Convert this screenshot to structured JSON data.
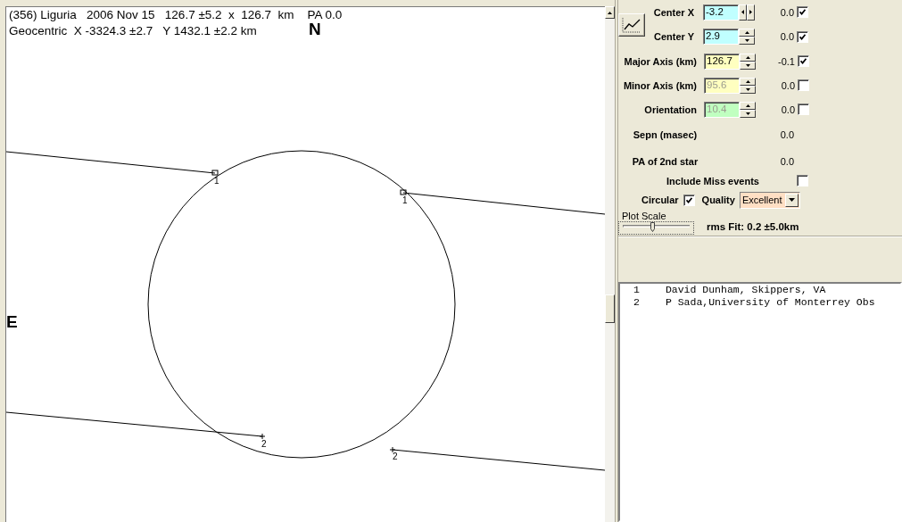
{
  "plot": {
    "header_lines": [
      "(356) Liguria   2006 Nov 15   126.7 ±5.2  x  126.7  km    PA 0.0",
      "Geocentric  X -3324.3 ±2.7   Y 1432.1 ±2.2 km"
    ],
    "north_label": "N",
    "east_label": "E",
    "chord_segments": [
      {
        "label": "1",
        "kind": "square"
      },
      {
        "label": "1",
        "kind": "square"
      },
      {
        "label": "2",
        "kind": "plus"
      },
      {
        "label": "2",
        "kind": "plus"
      }
    ]
  },
  "center_fields": [
    {
      "label": "Center X",
      "value": "-3.2",
      "color": "#c0ffff",
      "disabled": false,
      "horizontal_spinner": true,
      "delta": "0.0",
      "checked": true
    },
    {
      "label": "Center Y",
      "value": "2.9",
      "color": "#c0ffff",
      "disabled": false,
      "horizontal_spinner": false,
      "delta": "0.0",
      "checked": true
    }
  ],
  "parameters": [
    {
      "kind": "field",
      "label": "Major Axis (km)",
      "value": "126.7",
      "color": "#ffffc0",
      "disabled": false,
      "horizontal_spinner": false,
      "delta": "-0.1",
      "checked": true
    },
    {
      "kind": "field",
      "label": "Minor Axis (km)",
      "value": "95.6",
      "color": "#ffffc0",
      "disabled": true,
      "horizontal_spinner": false,
      "delta": "0.0",
      "checked": false
    },
    {
      "kind": "field",
      "label": "Orientation",
      "value": "10.4",
      "color": "#c0ffc0",
      "disabled": true,
      "horizontal_spinner": false,
      "delta": "0.0",
      "checked": false
    },
    {
      "kind": "readout",
      "label": "Sepn (masec)",
      "reading": "0.0"
    },
    {
      "kind": "readout",
      "label": "PA of 2nd star",
      "reading": "0.0"
    },
    {
      "kind": "checkbox",
      "label": "Include Miss events",
      "checked": false
    }
  ],
  "circular": {
    "label": "Circular",
    "checked": true
  },
  "quality": {
    "label": "Quality",
    "value": "Excellent"
  },
  "plot_scale": {
    "label": "Plot Scale",
    "level": 0.45
  },
  "rms_fit": "rms Fit: 0.2 ±5.0km",
  "observers": [
    {
      "number": "1",
      "name": "David Dunham, Skippers, VA"
    },
    {
      "number": "2",
      "name": "P Sada,University of Monterrey Obs"
    }
  ]
}
